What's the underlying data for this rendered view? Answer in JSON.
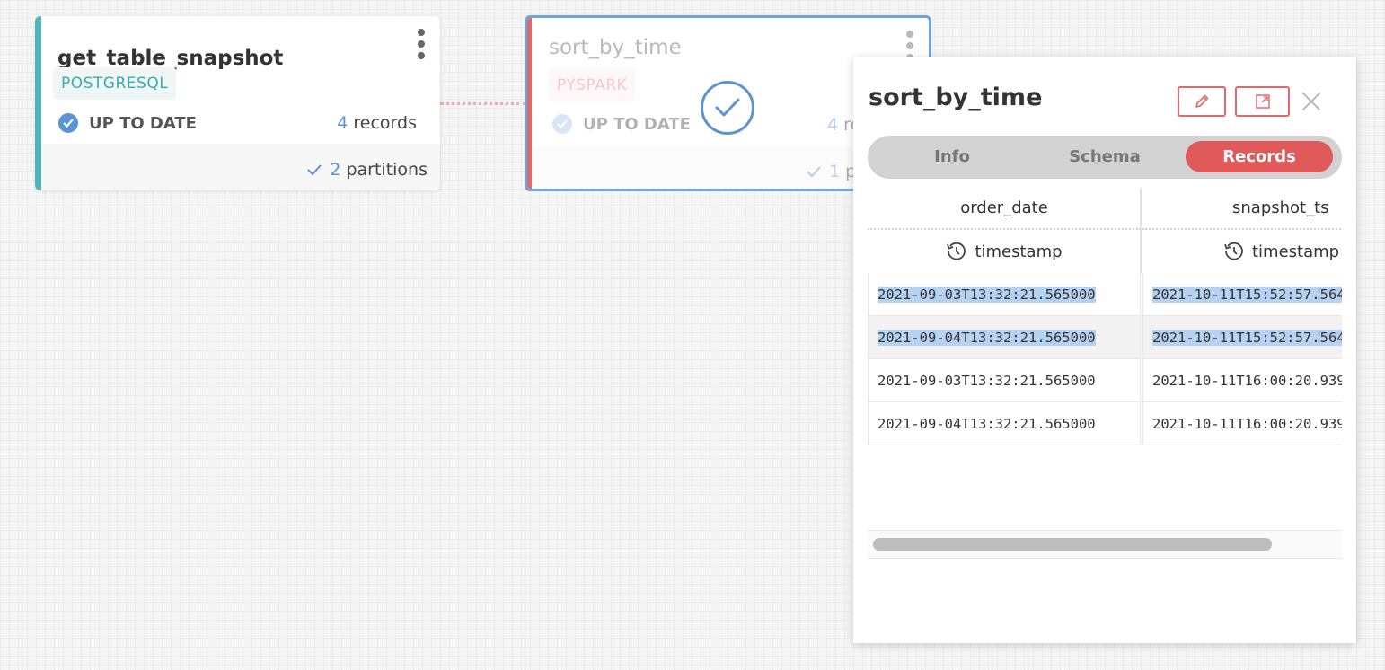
{
  "canvas": {
    "nodes": [
      {
        "title": "get_table_snapshot",
        "tag": "POSTGRESQL",
        "status": "UP TO DATE",
        "records_num": "4",
        "records_label": " records",
        "partitions_num": "2",
        "partitions_label": " partitions",
        "accent_color": "#4fb5b8"
      },
      {
        "title": "sort_by_time",
        "tag": "PYSPARK",
        "status": "UP TO DATE",
        "records_num": "4",
        "records_label": " re",
        "partitions_num": "1",
        "partitions_label": " p",
        "accent_color": "#e06a6a",
        "selected": true
      }
    ]
  },
  "panel": {
    "title": "sort_by_time",
    "buttons": {
      "edit_icon": "pencil-icon",
      "open_icon": "external-link-icon",
      "close_icon": "close-icon"
    },
    "tabs": [
      {
        "label": "Info",
        "active": false
      },
      {
        "label": "Schema",
        "active": false
      },
      {
        "label": "Records",
        "active": true
      }
    ],
    "table": {
      "columns": [
        {
          "name": "order_date",
          "type": "timestamp",
          "type_icon": "clock-history-icon"
        },
        {
          "name": "snapshot_ts",
          "type": "timestamp",
          "type_icon": "clock-history-icon"
        }
      ],
      "rows": [
        [
          "2021-09-03T13:32:21.565000",
          "2021-10-11T15:52:57.564"
        ],
        [
          "2021-09-04T13:32:21.565000",
          "2021-10-11T15:52:57.564"
        ],
        [
          "2021-09-03T13:32:21.565000",
          "2021-10-11T16:00:20.939"
        ],
        [
          "2021-09-04T13:32:21.565000",
          "2021-10-11T16:00:20.939"
        ]
      ],
      "highlighted_rows": [
        0,
        1
      ]
    }
  },
  "colors": {
    "accent_red": "#df5a58",
    "accent_blue": "#5b93d6",
    "teal": "#4fb5b8"
  }
}
